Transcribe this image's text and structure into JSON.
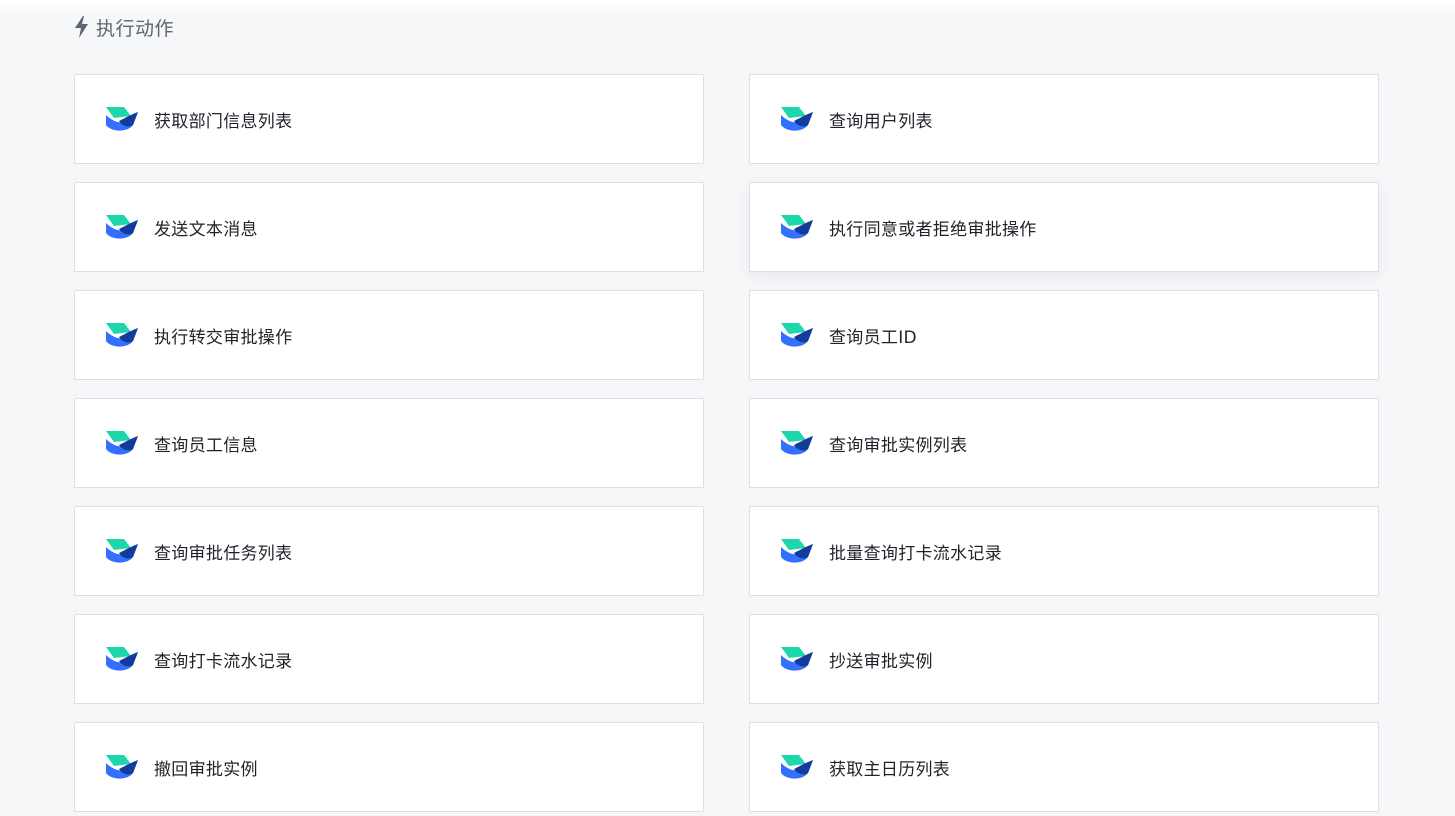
{
  "section": {
    "title": "执行动作",
    "icon": "bolt-icon"
  },
  "colors": {
    "background": "#f6f7f9",
    "card_border": "#dcdfe5",
    "icon_teal": "#1ed6ac",
    "icon_blue": "#3370ff",
    "icon_navy": "#133c9a"
  },
  "actions": [
    {
      "label": "获取部门信息列表",
      "icon": "lark-logo-icon"
    },
    {
      "label": "查询用户列表",
      "icon": "lark-logo-icon"
    },
    {
      "label": "发送文本消息",
      "icon": "lark-logo-icon"
    },
    {
      "label": "执行同意或者拒绝审批操作",
      "icon": "lark-logo-icon"
    },
    {
      "label": "执行转交审批操作",
      "icon": "lark-logo-icon"
    },
    {
      "label": "查询员工ID",
      "icon": "lark-logo-icon"
    },
    {
      "label": "查询员工信息",
      "icon": "lark-logo-icon"
    },
    {
      "label": "查询审批实例列表",
      "icon": "lark-logo-icon"
    },
    {
      "label": "查询审批任务列表",
      "icon": "lark-logo-icon"
    },
    {
      "label": "批量查询打卡流水记录",
      "icon": "lark-logo-icon"
    },
    {
      "label": "查询打卡流水记录",
      "icon": "lark-logo-icon"
    },
    {
      "label": "抄送审批实例",
      "icon": "lark-logo-icon"
    },
    {
      "label": "撤回审批实例",
      "icon": "lark-logo-icon"
    },
    {
      "label": "获取主日历列表",
      "icon": "lark-logo-icon"
    }
  ]
}
